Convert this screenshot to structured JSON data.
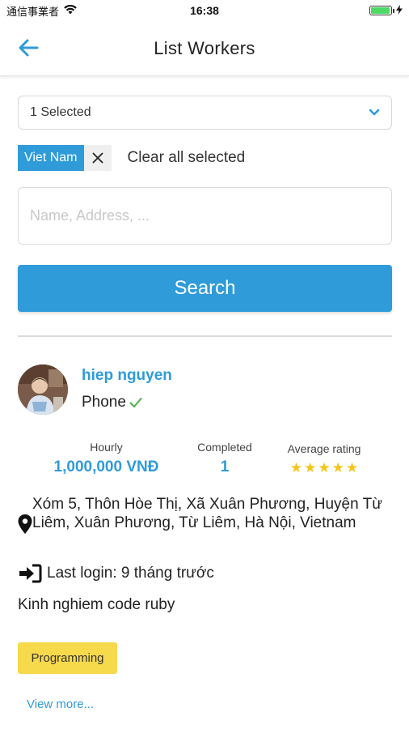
{
  "status_bar": {
    "carrier": "通信事業者",
    "time": "16:38",
    "battery_level": 0.95,
    "battery_color": "#4cd964"
  },
  "nav": {
    "back_icon": "arrow-left-icon",
    "title": "List Workers"
  },
  "filter": {
    "select_value": "1 Selected",
    "select_icon": "chevron-down-icon",
    "chips": [
      {
        "label": "Viet Nam"
      }
    ],
    "clear_all_label": "Clear all selected",
    "search_placeholder": "Name, Address, ...",
    "search_value": "",
    "search_button_label": "Search"
  },
  "worker": {
    "name": "hiep nguyen",
    "phone_label": "Phone",
    "phone_verified_icon": "checkmark-icon",
    "stats": {
      "hourly_label": "Hourly",
      "hourly_value": "1,000,000 VNĐ",
      "completed_label": "Completed",
      "completed_value": "1",
      "rating_label": "Average rating",
      "rating_value": 5,
      "rating_max": 5
    },
    "address_icon": "map-pin-icon",
    "address": "Xóm 5, Thôn Hòe Thị, Xã Xuân Phương, Huyện Từ Liêm, Xuân Phương, Từ Liêm, Hà Nội, Vietnam",
    "last_login_icon": "sign-in-icon",
    "last_login": "Last login: 9 tháng trước",
    "description": "Kinh nghiem code ruby",
    "tags": [
      "Programming"
    ],
    "view_more_label": "View more..."
  },
  "colors": {
    "accent": "#2f9bd9",
    "tag_background": "#f7d94c",
    "star": "#f5c518",
    "verified": "#4cae4c"
  }
}
